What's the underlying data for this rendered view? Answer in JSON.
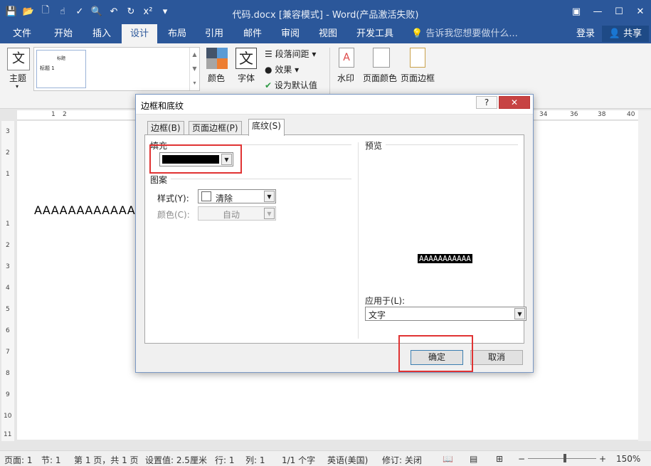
{
  "window": {
    "title": "代码.docx [兼容模式] - Word(产品激活失败)"
  },
  "menu": {
    "tabs": [
      "文件",
      "开始",
      "插入",
      "设计",
      "布局",
      "引用",
      "邮件",
      "审阅",
      "视图",
      "开发工具"
    ],
    "active_tab": "设计",
    "tell_me": "告诉我您想要做什么...",
    "login": "登录",
    "share": "共享"
  },
  "ribbon": {
    "theme_label": "主题",
    "gallery_thumb_title": "标题",
    "gallery_thumb_heading": "标题 1",
    "colors_label": "颜色",
    "fonts_label": "字体",
    "fonts_glyph": "文",
    "paragraph_spacing": "段落间距",
    "effects": "效果",
    "set_default": "设为默认值",
    "watermark": "水印",
    "page_color": "页面颜色",
    "page_borders": "页面边框"
  },
  "ruler": {
    "top_ticks": [
      "1",
      "2",
      "34",
      "36",
      "38",
      "40"
    ],
    "left_ticks": [
      "3",
      "2",
      "1",
      "1",
      "2",
      "3",
      "4",
      "5",
      "6",
      "7",
      "8",
      "9",
      "10",
      "11"
    ]
  },
  "document": {
    "body_text": "AAAAAAAAAAAA"
  },
  "dialog": {
    "title": "边框和底纹",
    "help": "?",
    "close": "✕",
    "tabs": [
      "边框(B)",
      "页面边框(P)",
      "底纹(S)"
    ],
    "active_tab": "底纹(S)",
    "fill_label": "填充",
    "fill_color": "#000000",
    "pattern_label": "图案",
    "style_label": "样式(Y):",
    "style_value": "清除",
    "color_label": "颜色(C):",
    "color_value": "自动",
    "preview_label": "预览",
    "preview_text": "AAAAAAAAAAA",
    "apply_to_label": "应用于(L):",
    "apply_to_value": "文字",
    "ok": "确定",
    "cancel": "取消"
  },
  "status": {
    "page": "页面: 1",
    "section": "节: 1",
    "page_of": "第 1 页，共 1 页",
    "setting": "设置值: 2.5厘米",
    "line": "行: 1",
    "column": "列: 1",
    "chars": "1/1 个字",
    "language": "英语(美国)",
    "track": "修订: 关闭",
    "zoom": "150%"
  }
}
